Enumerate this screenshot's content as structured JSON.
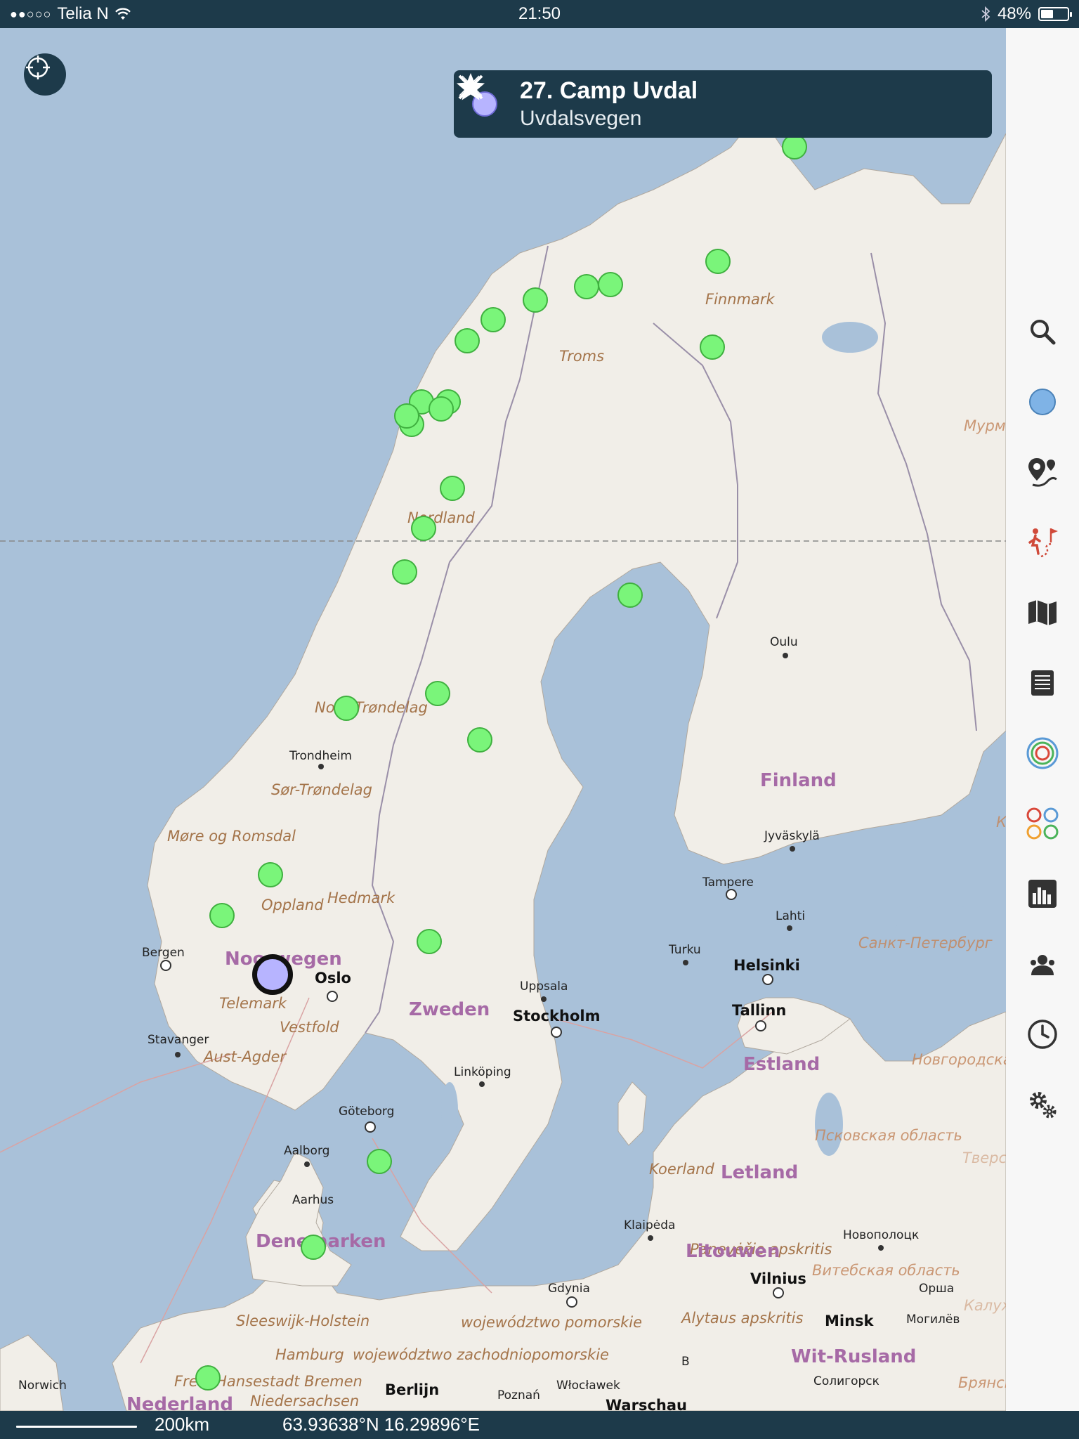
{
  "status_bar": {
    "signal": "●●○○○",
    "carrier": "Telia N",
    "time": "21:50",
    "battery": "48%",
    "battery_level": 0.48
  },
  "info_card": {
    "title": "27. Camp Uvdal",
    "subtitle": "Uvdalsvegen",
    "marker_color": "#b7b4ff"
  },
  "colors": {
    "ui_dark": "#1d3a4a",
    "water": "#a9c1d9",
    "land": "#f1eee8",
    "marker_fill": "#7af57a",
    "marker_selected": "#b7b4ff",
    "region_label": "#a4744a",
    "country_label": "#a66aa6"
  },
  "map": {
    "region_labels": [
      "Finnmark",
      "Troms",
      "Nordland",
      "Nord-Trøndelag",
      "Sør-Trøndelag",
      "Møre og Romsdal",
      "Oppland",
      "Hedmark",
      "Telemark",
      "Vestfold",
      "Aust-Agder",
      "Sleeswijk-Holstein",
      "Hamburg",
      "województwo zachodniopomorskie",
      "województwo pomorskie",
      "Freie Hansestadt Bremen",
      "Niedersachsen",
      "Koerland",
      "Panevėžio apskritis",
      "Alytaus apskritis",
      "Мурманская область",
      "Санкт-Петербург",
      "Новгородская область",
      "Псковская область",
      "Витебская область",
      "Брянская область",
      "Тверская",
      "Калужская",
      "Карелия"
    ],
    "country_labels": [
      "Noorwegen",
      "Zweden",
      "Finland",
      "Estland",
      "Letland",
      "Litouwen",
      "Denemarken",
      "Wit-Rusland",
      "Nederland"
    ],
    "city_labels": [
      "Oulu",
      "Trondheim",
      "Jyväskylä",
      "Tampere",
      "Lahti",
      "Turku",
      "Bergen",
      "Stavanger",
      "Uppsala",
      "Linköping",
      "Göteborg",
      "Aalborg",
      "Aarhus",
      "Klaipėda",
      "Новополоцк",
      "Gdynia",
      "Орша",
      "Могилёв",
      "Солигорск",
      "Norwich",
      "Poznań",
      "Włocławek",
      "B"
    ],
    "capital_labels": [
      "Oslo",
      "Stockholm",
      "Helsinki",
      "Tallinn",
      "Vilnius",
      "Minsk",
      "Berlijn",
      "Warschau"
    ],
    "marker_count": 28,
    "selected_marker": "27. Camp Uvdal"
  },
  "toolbar": {
    "items": [
      "search-icon",
      "layer-dot-icon",
      "route-pins-icon",
      "trail-icon",
      "map-icon",
      "list-icon",
      "tracks-icon",
      "groups-icon",
      "stats-icon",
      "users-icon",
      "clock-icon",
      "settings-icon"
    ]
  },
  "bottom_bar": {
    "scale": "200km",
    "coordinates": "63.93638°N 16.29896°E"
  }
}
